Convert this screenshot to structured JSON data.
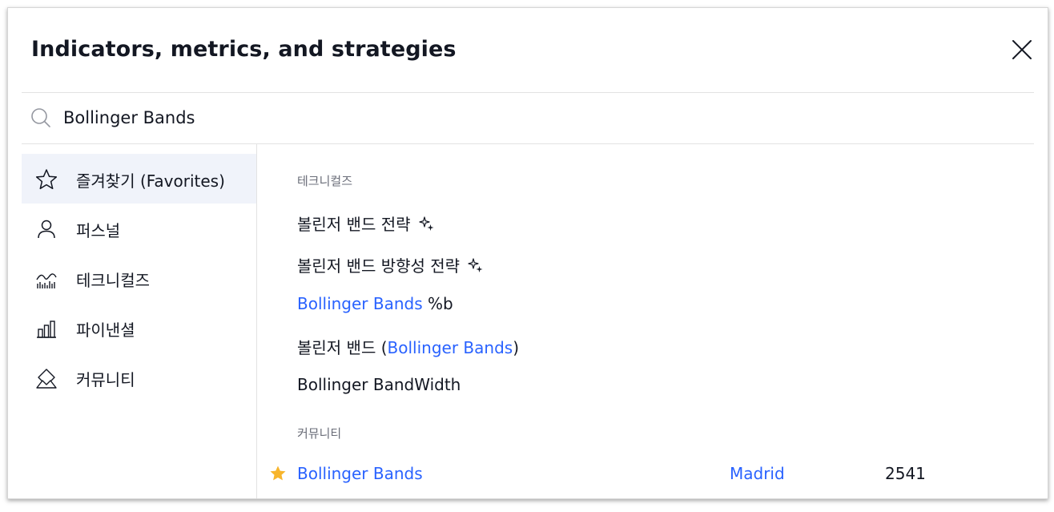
{
  "dialog": {
    "title": "Indicators, metrics, and strategies",
    "close_icon": "close-icon"
  },
  "search": {
    "value": "Bollinger Bands",
    "placeholder": "Search",
    "icon": "search-icon"
  },
  "sidebar": {
    "items": [
      {
        "label": "즐겨찾기 (Favorites)",
        "icon": "star-outline-icon",
        "active": true
      },
      {
        "label": "퍼스널",
        "icon": "person-icon",
        "active": false
      },
      {
        "label": "테크니컬즈",
        "icon": "technicals-chart-icon",
        "active": false
      },
      {
        "label": "파이낸셜",
        "icon": "bar-chart-icon",
        "active": false
      },
      {
        "label": "커뮤니티",
        "icon": "community-icon",
        "active": false
      }
    ]
  },
  "results": {
    "technicals_header": "테크니컬즈",
    "technicals": [
      {
        "text": "볼린저 밴드 전략",
        "icon": "strategy-sparkle-icon"
      },
      {
        "text": "볼린저 밴드 방향성 전략",
        "icon": "strategy-sparkle-icon"
      },
      {
        "name_blue": "Bollinger Bands",
        "suffix": " %b"
      },
      {
        "prefix": "볼린저 밴드 (",
        "name_blue": "Bollinger Bands",
        "suffix": ")"
      },
      {
        "text": "Bollinger BandWidth"
      }
    ],
    "community_header": "커뮤니티",
    "community": [
      {
        "name": "Bollinger Bands",
        "author": "Madrid",
        "likes": "2541",
        "icon": "favorite-star-icon"
      }
    ]
  },
  "colors": {
    "accent_blue": "#2962ff",
    "star_gold": "#f7b52c",
    "active_bg": "#f0f3fa",
    "text": "#131722",
    "muted": "#6a6d78"
  }
}
